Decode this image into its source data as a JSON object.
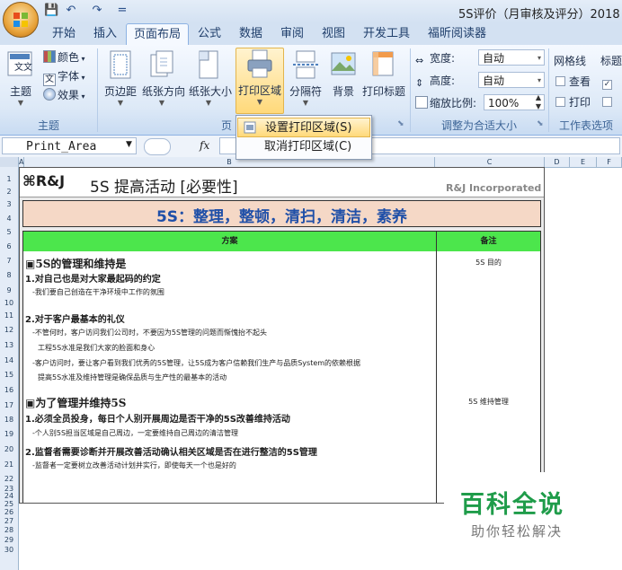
{
  "window": {
    "title": "5S评价（月审核及评分）2018",
    "qat": {
      "save": "💾",
      "undo": "↶",
      "redo": "↷",
      "customize": "="
    }
  },
  "tabs": [
    "开始",
    "插入",
    "页面布局",
    "公式",
    "数据",
    "审阅",
    "视图",
    "开发工具",
    "福昕阅读器"
  ],
  "active_tab": "页面布局",
  "ribbon": {
    "theme_group": {
      "label": "主题",
      "theme_button": "主题",
      "colors": "颜色",
      "fonts": "字体",
      "effects": "效果"
    },
    "page_setup_group": {
      "label": "页",
      "margins": "页边距",
      "orientation": "纸张方向",
      "size": "纸张大小",
      "print_area": "打印区域",
      "breaks": "分隔符",
      "background": "背景",
      "print_titles": "打印标题"
    },
    "scale_group": {
      "label": "调整为合适大小",
      "width_label": "宽度:",
      "width_value": "自动",
      "height_label": "高度:",
      "height_value": "自动",
      "scale_label": "缩放比例:",
      "scale_value": "100%"
    },
    "sheet_options_group": {
      "label": "工作表选项",
      "gridlines": "网格线",
      "view": "查看",
      "print": "打印",
      "headings": "标题"
    }
  },
  "dropdown": {
    "set_print_area": "设置打印区域(S)",
    "clear_print_area": "取消打印区域(C)"
  },
  "formula_bar": {
    "name_box": "Print_Area",
    "fx": "fx"
  },
  "columns": [
    "A",
    "B",
    "C",
    "D",
    "E",
    "F"
  ],
  "rows": [
    "1",
    "2",
    "3",
    "4",
    "5",
    "6",
    "7",
    "8",
    "9",
    "10",
    "11",
    "12",
    "13",
    "14",
    "15",
    "16",
    "17",
    "18",
    "19",
    "20",
    "21",
    "22",
    "23",
    "24",
    "25",
    "26",
    "27",
    "28",
    "29",
    "30"
  ],
  "sheet": {
    "logo_text": "R&J",
    "title": "5S 提高活动 [必要性]",
    "company": "R&J Incorporated",
    "banner": "5S：整理，整顿，清扫，清洁，素养",
    "header_plan": "方案",
    "header_remark": "备注",
    "lines": [
      {
        "text": "▣5S的管理和维持是",
        "remark": "5S 目的"
      },
      {
        "text": "1.对自己也是对大家最起码的约定",
        "remark": ""
      },
      {
        "text": "-我们要自己创造在干净环境中工作的氛围",
        "remark": ""
      },
      {
        "text": "",
        "remark": ""
      },
      {
        "text": "2.对于客户最基本的礼仪",
        "remark": ""
      },
      {
        "text": "-不管何时，客户访问我们公司时，不要因为5S管理的问题而惭愧抬不起头",
        "remark": ""
      },
      {
        "text": "工程5S水准是我们大家的脸面和身心",
        "remark": ""
      },
      {
        "text": "-客户访问时，要让客户看到我们优秀的5S管理，让5S成为客户信赖我们生产与品质System的依赖根据",
        "remark": ""
      },
      {
        "text": "提高5S水准及维持管理是确保品质与生产性的最基本的活动",
        "remark": ""
      },
      {
        "text": "▣为了管理并维持5S",
        "remark": "5S 维持管理"
      },
      {
        "text": "1.必须全员投身，每日个人别开展周边是否干净的5S改善维持活动",
        "remark": ""
      },
      {
        "text": "-个人别5S担当区域是自己周边，一定要维持自己周边的清洁管理",
        "remark": ""
      },
      {
        "text": "2.监督者需要诊断并开展改善活动确认相关区域是否在进行整洁的5S管理",
        "remark": ""
      },
      {
        "text": "-监督者一定要树立改善活动计划并实行，即使每天一个也是好的",
        "remark": ""
      }
    ]
  },
  "watermark": {
    "title": "百科全说",
    "subtitle": "助你轻松解决"
  },
  "colors": {
    "banner_bg": "#f5d8c6",
    "banner_text": "#1f4fa8",
    "header_green": "#4ce64c",
    "watermark_green": "#1f9c4a"
  }
}
